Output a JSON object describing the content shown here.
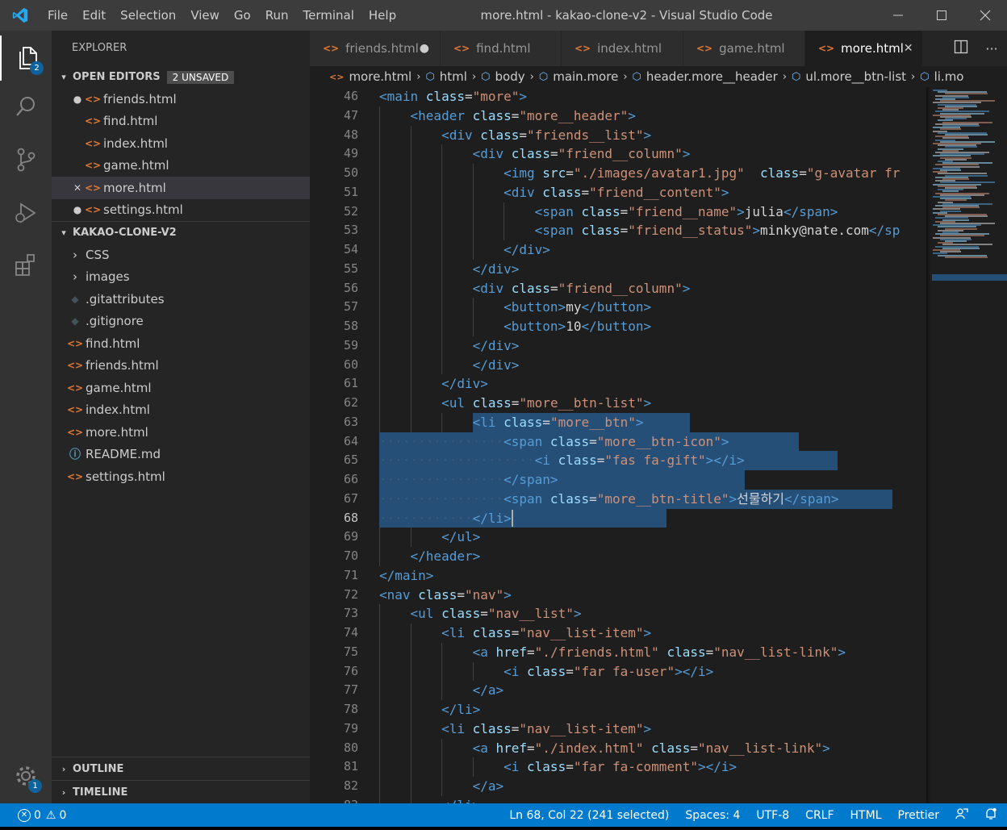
{
  "window": {
    "title": "more.html - kakao-clone-v2 - Visual Studio Code",
    "menu": [
      "File",
      "Edit",
      "Selection",
      "View",
      "Go",
      "Run",
      "Terminal",
      "Help"
    ]
  },
  "activity": {
    "explorer_badge": "2",
    "settings_badge": "1"
  },
  "explorer": {
    "title": "EXPLORER",
    "open_editors_label": "OPEN EDITORS",
    "unsaved_label": "2 UNSAVED",
    "open_editors": [
      {
        "name": "friends.html",
        "mark": "●"
      },
      {
        "name": "find.html",
        "mark": ""
      },
      {
        "name": "index.html",
        "mark": ""
      },
      {
        "name": "game.html",
        "mark": ""
      },
      {
        "name": "more.html",
        "mark": "✕"
      },
      {
        "name": "settings.html",
        "mark": "●"
      }
    ],
    "project_label": "KAKAO-CLONE-V2",
    "tree": [
      {
        "name": "CSS",
        "kind": "folder"
      },
      {
        "name": "images",
        "kind": "folder"
      },
      {
        "name": ".gitattributes",
        "kind": "git"
      },
      {
        "name": ".gitignore",
        "kind": "git"
      },
      {
        "name": "find.html",
        "kind": "html"
      },
      {
        "name": "friends.html",
        "kind": "html"
      },
      {
        "name": "game.html",
        "kind": "html"
      },
      {
        "name": "index.html",
        "kind": "html"
      },
      {
        "name": "more.html",
        "kind": "html"
      },
      {
        "name": "README.md",
        "kind": "info"
      },
      {
        "name": "settings.html",
        "kind": "html"
      }
    ],
    "outline_label": "OUTLINE",
    "timeline_label": "TIMELINE"
  },
  "tabs": [
    {
      "name": "friends.html",
      "state": "●"
    },
    {
      "name": "find.html",
      "state": ""
    },
    {
      "name": "index.html",
      "state": ""
    },
    {
      "name": "game.html",
      "state": ""
    },
    {
      "name": "more.html",
      "state": "✕"
    }
  ],
  "breadcrumb": [
    "more.html",
    "html",
    "body",
    "main.more",
    "header.more__header",
    "ul.more__btn-list",
    "li.mo"
  ],
  "editor": {
    "first_line": 46,
    "lines": [
      {
        "i": 2,
        "t": [
          [
            "tag",
            "<main "
          ],
          [
            "attr",
            "class"
          ],
          [
            "txt",
            "="
          ],
          [
            "str",
            "\"more\""
          ],
          [
            "tag",
            ">"
          ]
        ]
      },
      {
        "i": 3,
        "t": [
          [
            "tag",
            "<header "
          ],
          [
            "attr",
            "class"
          ],
          [
            "txt",
            "="
          ],
          [
            "str",
            "\"more__header\""
          ],
          [
            "tag",
            ">"
          ]
        ]
      },
      {
        "i": 4,
        "t": [
          [
            "tag",
            "<div "
          ],
          [
            "attr",
            "class"
          ],
          [
            "txt",
            "="
          ],
          [
            "str",
            "\"friends__list\""
          ],
          [
            "tag",
            ">"
          ]
        ]
      },
      {
        "i": 5,
        "t": [
          [
            "tag",
            "<div "
          ],
          [
            "attr",
            "class"
          ],
          [
            "txt",
            "="
          ],
          [
            "str",
            "\"friend__column\""
          ],
          [
            "tag",
            ">"
          ]
        ]
      },
      {
        "i": 6,
        "t": [
          [
            "tag",
            "<img "
          ],
          [
            "attr",
            "src"
          ],
          [
            "txt",
            "="
          ],
          [
            "str",
            "\"./images/avatar1.jpg\""
          ],
          [
            "txt",
            "  "
          ],
          [
            "attr",
            "class"
          ],
          [
            "txt",
            "="
          ],
          [
            "str",
            "\"g-avatar fr"
          ]
        ]
      },
      {
        "i": 6,
        "t": [
          [
            "tag",
            "<div "
          ],
          [
            "attr",
            "class"
          ],
          [
            "txt",
            "="
          ],
          [
            "str",
            "\"friend__content\""
          ],
          [
            "tag",
            ">"
          ]
        ]
      },
      {
        "i": 7,
        "t": [
          [
            "tag",
            "<span "
          ],
          [
            "attr",
            "class"
          ],
          [
            "txt",
            "="
          ],
          [
            "str",
            "\"friend__name\""
          ],
          [
            "tag",
            ">"
          ],
          [
            "txt",
            "julia"
          ],
          [
            "tag",
            "</span>"
          ]
        ]
      },
      {
        "i": 7,
        "t": [
          [
            "tag",
            "<span "
          ],
          [
            "attr",
            "class"
          ],
          [
            "txt",
            "="
          ],
          [
            "str",
            "\"friend__status\""
          ],
          [
            "tag",
            ">"
          ],
          [
            "txt",
            "minky@nate.com"
          ],
          [
            "tag",
            "</sp"
          ]
        ]
      },
      {
        "i": 6,
        "t": [
          [
            "tag",
            "</div>"
          ]
        ]
      },
      {
        "i": 5,
        "t": [
          [
            "tag",
            "</div>"
          ]
        ]
      },
      {
        "i": 5,
        "t": [
          [
            "tag",
            "<div "
          ],
          [
            "attr",
            "class"
          ],
          [
            "txt",
            "="
          ],
          [
            "str",
            "\"friend__column\""
          ],
          [
            "tag",
            ">"
          ]
        ]
      },
      {
        "i": 6,
        "t": [
          [
            "tag",
            "<button>"
          ],
          [
            "txt",
            "my"
          ],
          [
            "tag",
            "</button>"
          ]
        ]
      },
      {
        "i": 6,
        "t": [
          [
            "tag",
            "<button>"
          ],
          [
            "txt",
            "10"
          ],
          [
            "tag",
            "</button>"
          ]
        ]
      },
      {
        "i": 5,
        "t": [
          [
            "tag",
            "</div>"
          ]
        ]
      },
      {
        "i": 5,
        "t": [
          [
            "tag",
            "</div>"
          ]
        ]
      },
      {
        "i": 4,
        "t": [
          [
            "tag",
            "</div>"
          ]
        ]
      },
      {
        "i": 4,
        "t": [
          [
            "tag",
            "<ul "
          ],
          [
            "attr",
            "class"
          ],
          [
            "txt",
            "="
          ],
          [
            "str",
            "\"more__btn-list\""
          ],
          [
            "tag",
            ">"
          ]
        ]
      },
      {
        "i": 5,
        "t": [
          [
            "tag",
            "<li "
          ],
          [
            "attr",
            "class"
          ],
          [
            "txt",
            "="
          ],
          [
            "str",
            "\"more__btn\""
          ],
          [
            "tag",
            ">"
          ]
        ],
        "sel": [
          5,
          28
        ]
      },
      {
        "i": 6,
        "t": [
          [
            "tag",
            "<span "
          ],
          [
            "attr",
            "class"
          ],
          [
            "txt",
            "="
          ],
          [
            "str",
            "\"more__btn-icon\""
          ],
          [
            "tag",
            ">"
          ]
        ],
        "sel": [
          0,
          38
        ]
      },
      {
        "i": 7,
        "t": [
          [
            "tag",
            "<i "
          ],
          [
            "attr",
            "class"
          ],
          [
            "txt",
            "="
          ],
          [
            "str",
            "\"fas fa-gift\""
          ],
          [
            "tag",
            "></i>"
          ]
        ],
        "sel": [
          0,
          39
        ]
      },
      {
        "i": 6,
        "t": [
          [
            "tag",
            "</span>"
          ]
        ],
        "sel": [
          0,
          31
        ]
      },
      {
        "i": 6,
        "t": [
          [
            "tag",
            "<span "
          ],
          [
            "attr",
            "class"
          ],
          [
            "txt",
            "="
          ],
          [
            "str",
            "\"more__btn-title\""
          ],
          [
            "tag",
            ">"
          ],
          [
            "txt",
            "선물하기"
          ],
          [
            "tag",
            "</span>"
          ]
        ],
        "sel": [
          0,
          50
        ]
      },
      {
        "i": 5,
        "t": [
          [
            "tag",
            "</li>"
          ]
        ],
        "sel": [
          0,
          25
        ],
        "cursor": true
      },
      {
        "i": 4,
        "t": [
          [
            "tag",
            "</ul>"
          ]
        ]
      },
      {
        "i": 3,
        "t": [
          [
            "tag",
            "</header>"
          ]
        ]
      },
      {
        "i": 2,
        "t": [
          [
            "tag",
            "</main>"
          ]
        ]
      },
      {
        "i": 2,
        "t": [
          [
            "tag",
            "<nav "
          ],
          [
            "attr",
            "class"
          ],
          [
            "txt",
            "="
          ],
          [
            "str",
            "\"nav\""
          ],
          [
            "tag",
            ">"
          ]
        ]
      },
      {
        "i": 3,
        "t": [
          [
            "tag",
            "<ul "
          ],
          [
            "attr",
            "class"
          ],
          [
            "txt",
            "="
          ],
          [
            "str",
            "\"nav__list\""
          ],
          [
            "tag",
            ">"
          ]
        ]
      },
      {
        "i": 4,
        "t": [
          [
            "tag",
            "<li "
          ],
          [
            "attr",
            "class"
          ],
          [
            "txt",
            "="
          ],
          [
            "str",
            "\"nav__list-item\""
          ],
          [
            "tag",
            ">"
          ]
        ]
      },
      {
        "i": 5,
        "t": [
          [
            "tag",
            "<a "
          ],
          [
            "attr",
            "href"
          ],
          [
            "txt",
            "="
          ],
          [
            "str",
            "\"./friends.html\""
          ],
          [
            "txt",
            " "
          ],
          [
            "attr",
            "class"
          ],
          [
            "txt",
            "="
          ],
          [
            "str",
            "\"nav__list-link\""
          ],
          [
            "tag",
            ">"
          ]
        ]
      },
      {
        "i": 6,
        "t": [
          [
            "tag",
            "<i "
          ],
          [
            "attr",
            "class"
          ],
          [
            "txt",
            "="
          ],
          [
            "str",
            "\"far fa-user\""
          ],
          [
            "tag",
            "></i>"
          ]
        ]
      },
      {
        "i": 5,
        "t": [
          [
            "tag",
            "</a>"
          ]
        ]
      },
      {
        "i": 4,
        "t": [
          [
            "tag",
            "</li>"
          ]
        ]
      },
      {
        "i": 4,
        "t": [
          [
            "tag",
            "<li "
          ],
          [
            "attr",
            "class"
          ],
          [
            "txt",
            "="
          ],
          [
            "str",
            "\"nav__list-item\""
          ],
          [
            "tag",
            ">"
          ]
        ]
      },
      {
        "i": 5,
        "t": [
          [
            "tag",
            "<a "
          ],
          [
            "attr",
            "href"
          ],
          [
            "txt",
            "="
          ],
          [
            "str",
            "\"./index.html\""
          ],
          [
            "txt",
            " "
          ],
          [
            "attr",
            "class"
          ],
          [
            "txt",
            "="
          ],
          [
            "str",
            "\"nav__list-link\""
          ],
          [
            "tag",
            ">"
          ]
        ]
      },
      {
        "i": 6,
        "t": [
          [
            "tag",
            "<i "
          ],
          [
            "attr",
            "class"
          ],
          [
            "txt",
            "="
          ],
          [
            "str",
            "\"far fa-comment\""
          ],
          [
            "tag",
            "></i>"
          ]
        ]
      },
      {
        "i": 5,
        "t": [
          [
            "tag",
            "</a>"
          ]
        ]
      },
      {
        "i": 4,
        "t": [
          [
            "tag",
            "</li>"
          ]
        ]
      }
    ]
  },
  "status": {
    "errors": "0",
    "warnings": "0",
    "position": "Ln 68, Col 22 (241 selected)",
    "spaces": "Spaces: 4",
    "encoding": "UTF-8",
    "eol": "CRLF",
    "language": "HTML",
    "formatter": "Prettier"
  },
  "colors": {
    "accent": "#007acc",
    "selection": "#264f78",
    "html_icon": "#e37933"
  }
}
